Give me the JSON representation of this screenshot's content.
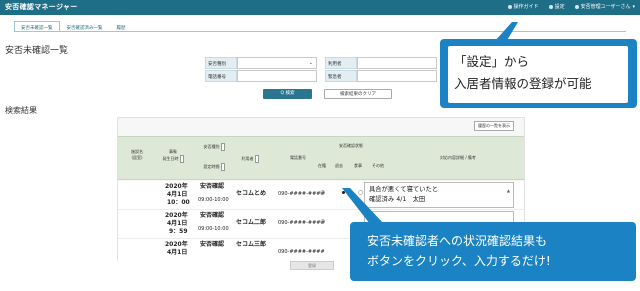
{
  "header": {
    "app_title": "安否確認マネージャー",
    "nav": [
      {
        "label": "操作ガイド",
        "icon": "guide-icon"
      },
      {
        "label": "設定",
        "icon": "gear-icon"
      },
      {
        "label": "安否管理ユーザーさん",
        "icon": "user-icon"
      }
    ],
    "user_caret": "▾"
  },
  "tabs": [
    {
      "label": "安否未確認一覧"
    },
    {
      "label": "安否確認済み一覧"
    },
    {
      "label": "履歴"
    }
  ],
  "page_title": "安否未確認一覧",
  "form": {
    "row1": {
      "label_a": "安否種別",
      "value_a": "",
      "label_b": "利用者",
      "value_b": ""
    },
    "row2": {
      "label_a": "電話番号",
      "value_a": "",
      "label_b": "緊急者",
      "value_b": ""
    },
    "select_arrow": "⌄"
  },
  "buttons": {
    "search": "Q 検索",
    "clear": "検索結果のクリア",
    "register": "登録"
  },
  "result_title": "検索結果",
  "table": {
    "show_history": "履歴の一覧を表示",
    "headers": {
      "house": "施設名\n(居室)",
      "datetime": "事象\n発生日時",
      "type": "安否種別",
      "type2": "設定時間",
      "user": "利用者",
      "phone": "電話番号",
      "status": "安否確認状態",
      "st": [
        "在籍",
        "退去",
        "食事",
        "その他"
      ],
      "memo": "対応内容詳細 / 備考"
    },
    "rows": [
      {
        "date": "2020年",
        "md": "4月1日",
        "time": "10：00",
        "type": "安否確認",
        "setting": "09:00-10:00",
        "user": "セコムとめ",
        "phone": "090-####-####",
        "memo": [
          "具合が悪くて寝ていたと",
          "確認済み 4/1　太田"
        ]
      },
      {
        "date": "2020年",
        "md": "4月1日",
        "time": "9：59",
        "type": "安否確認",
        "setting": "09:00-10:00",
        "user": "セコム二郎",
        "phone": "090-####-####",
        "memo": []
      },
      {
        "date": "2020年",
        "md": "4月1日",
        "time": "",
        "type": "安否確認",
        "setting": "",
        "user": "セコム三郎",
        "phone": "090-####-####",
        "memo": []
      }
    ],
    "circle": "○",
    "scroll_glyph": "▲"
  },
  "callouts": {
    "settings": {
      "line1": "「設定」から",
      "line2": "入居者情報の登録が可能"
    },
    "confirm": {
      "line1": "安否未確認者への状況確認結果も",
      "line2": "ボタンをクリック、入力するだけ!"
    }
  },
  "colors": {
    "header": "#1f6e88",
    "callout": "#1b83c3",
    "table_header": "#dde9d6"
  }
}
